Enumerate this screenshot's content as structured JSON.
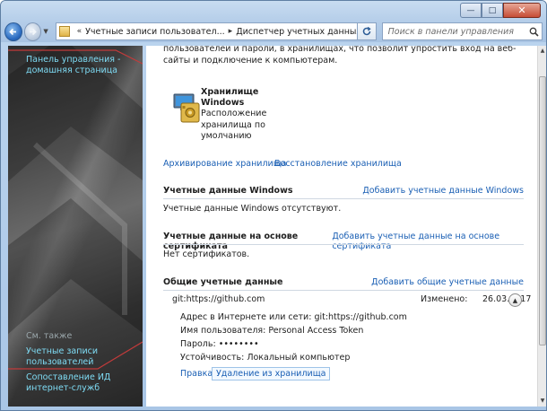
{
  "titlebar": {
    "caption_minimize": "—",
    "caption_maximize": "□",
    "caption_close": "✕"
  },
  "address": {
    "crumb_prefix": "«",
    "crumbs": [
      "Учетные записи пользовател...",
      "Диспетчер учетных данных"
    ],
    "separator": "▸"
  },
  "search": {
    "placeholder": "Поиск в панели управления"
  },
  "sidebar": {
    "home_link": "Панель управления - домашняя страница",
    "see_also": "См. также",
    "user_accounts": "Учетные записи пользователей",
    "id_mapping": "Сопоставление ИД интернет-служб"
  },
  "main": {
    "intro": "пользователей и пароли, в хранилищах, что позволит упростить вход на веб-сайты и подключение к компьютерам.",
    "vault": {
      "title": "Хранилище Windows",
      "description": "Расположение хранилища по умолчанию"
    },
    "backup_link": "Архивирование хранилища",
    "restore_link": "Восстановление хранилища",
    "windows_section": {
      "title": "Учетные данные Windows",
      "add_link": "Добавить учетные данные Windows",
      "empty_text": "Учетные данные Windows отсутствуют."
    },
    "cert_section": {
      "title": "Учетные данные на основе сертификата",
      "add_link": "Добавить учетные данные на основе сертификата",
      "empty_text": "Нет сертификатов."
    },
    "generic_section": {
      "title": "Общие учетные данные",
      "add_link": "Добавить общие учетные данные",
      "credential": {
        "name": "git:https://github.com",
        "modified_label": "Изменено:",
        "modified_date": "26.03.2017",
        "address_label": "Адрес в Интернете или сети:",
        "address_value": "git:https://github.com",
        "user_label": "Имя пользователя:",
        "user_value": "Personal Access Token",
        "password_label": "Пароль:",
        "password_value": "••••••••",
        "persistence_label": "Устойчивость:",
        "persistence_value": "Локальный компьютер",
        "edit_link": "Правка",
        "remove_link": "Удаление из хранилища"
      }
    }
  },
  "colors": {
    "link": "#1a5fb4",
    "sidebar_link": "#7fdcf5",
    "titlebar": "#b3cce8"
  }
}
